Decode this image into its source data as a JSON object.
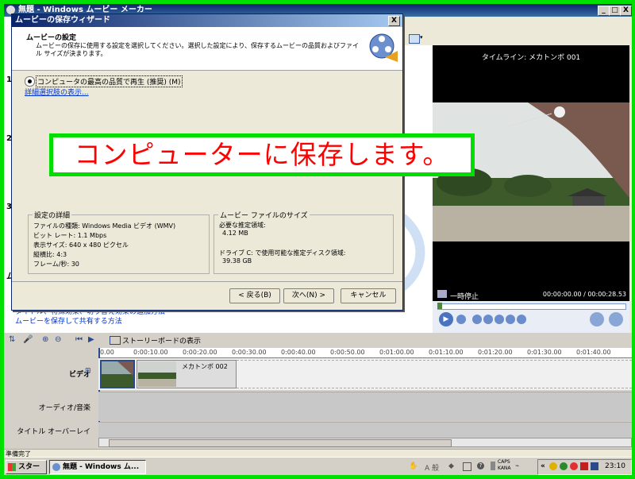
{
  "app": {
    "title": "無題 - Windows ムービー メーカー",
    "buttons": [
      "_",
      "□",
      "X"
    ],
    "side_numbers": [
      "1",
      "2",
      "3",
      "ム"
    ],
    "help_links": [
      "タイトル、特殊効果、切り替え効果の追加方法",
      "ムービーを保存して共有する方法"
    ],
    "toolbar_icon": "storyboard-grid-icon"
  },
  "wizard": {
    "title": "ムービーの保存ウィザード",
    "close": "X",
    "header_title": "ムービーの設定",
    "header_desc": "ムービーの保存に使用する設定を選択してください。選択した設定により、保存するムービーの品質およびファイル サイズが決まります。",
    "radio_label": "コンピュータの最高の品質で再生 (推奨) (M)",
    "more_options_link": "詳細選択肢の表示...",
    "details": {
      "title": "設定の詳細",
      "lines": [
        "ファイルの種類: Windows Media ビデオ (WMV)",
        "ビット レート: 1.1 Mbps",
        "表示サイズ: 640 x 480 ピクセル",
        "縦横比: 4:3",
        "フレーム/秒: 30"
      ]
    },
    "filesize": {
      "title": "ムービー ファイルのサイズ",
      "estimate_label": "必要な推定領域:",
      "estimate_value": "4.12 MB",
      "disk_label": "ドライブ C: で使用可能な推定ディスク領域:",
      "disk_value": "39.38 GB"
    },
    "back_button": "< 戻る(B)",
    "next_button": "次へ(N) >",
    "cancel_button": "キャンセル"
  },
  "banner": {
    "text": "コンピューターに保存します。"
  },
  "preview": {
    "title": "タイムライン: メカトンボ 001",
    "status": "一時停止",
    "time": "00:00:00.00 / 00:00:28.53"
  },
  "timeline": {
    "storyboard_label": "ストーリーボードの表示",
    "ticks": [
      "0.00",
      "0:00:10.00",
      "0:00:20.00",
      "0:00:30.00",
      "0:00:40.00",
      "0:00:50.00",
      "0:01:00.00",
      "0:01:10.00",
      "0:01:20.00",
      "0:01:30.00",
      "0:01:40.00"
    ],
    "tracks": {
      "video": "ビデオ",
      "audio": "オーディオ/音楽",
      "title": "タイトル オーバーレイ"
    },
    "clip2_label": "メカトンボ 002"
  },
  "statusbar": {
    "text": "準備完了"
  },
  "taskbar": {
    "start": "スタート",
    "task": "無題 - Windows ム...",
    "ime_label": "A 般",
    "caps": "CAPS",
    "kana": "KANA",
    "clock": "23:10"
  }
}
